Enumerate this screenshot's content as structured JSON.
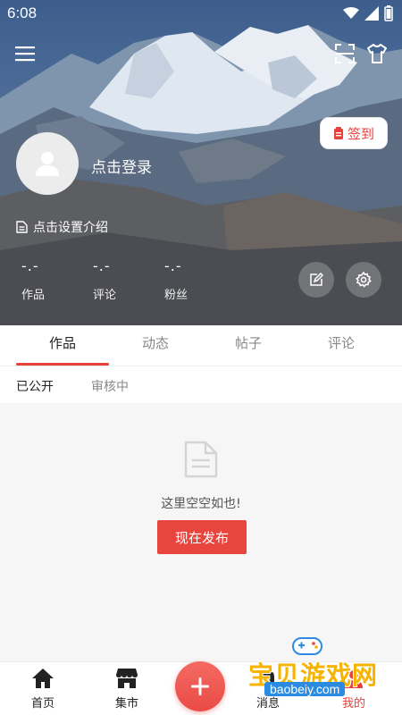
{
  "status_bar": {
    "time": "6:08"
  },
  "profile": {
    "login_prompt": "点击登录",
    "intro_prompt": "点击设置介绍",
    "checkin_label": "签到"
  },
  "stats": [
    {
      "value": "-.-",
      "label": "作品"
    },
    {
      "value": "-.-",
      "label": "评论"
    },
    {
      "value": "-.-",
      "label": "粉丝"
    }
  ],
  "tabs": [
    "作品",
    "动态",
    "帖子",
    "评论"
  ],
  "active_tab": "作品",
  "subtabs": [
    "已公开",
    "审核中"
  ],
  "empty_state": {
    "message": "这里空空如也!",
    "button_label": "现在发布"
  },
  "bottom_nav": [
    {
      "label": "首页",
      "icon": "home-icon"
    },
    {
      "label": "集市",
      "icon": "store-icon"
    },
    {
      "label": "消息",
      "icon": "bell-icon"
    },
    {
      "label": "我的",
      "icon": "profile-icon"
    }
  ],
  "watermark": {
    "title": "宝贝游戏网",
    "url": "baobeiy.com"
  },
  "colors": {
    "accent": "#e8413c",
    "content_bg": "#f6f6f6"
  }
}
